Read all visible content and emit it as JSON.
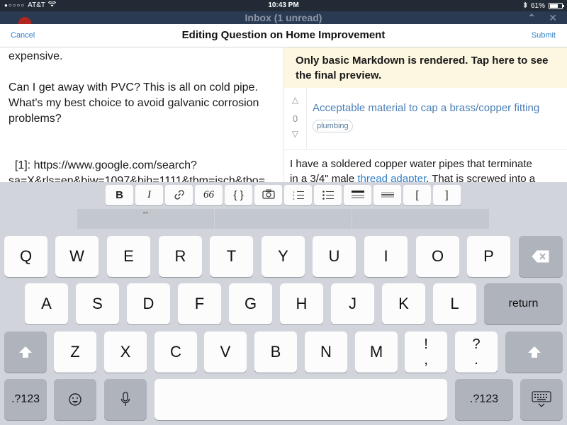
{
  "status_bar": {
    "carrier": "AT&T",
    "time": "10:43 PM",
    "battery": "61%"
  },
  "background_app": {
    "title": "Inbox (1 unread)"
  },
  "sheet": {
    "cancel_label": "Cancel",
    "title": "Editing Question on Home Improvement",
    "submit_label": "Submit"
  },
  "editor": {
    "lines": [
      "expensive.",
      "Can I get away with PVC?  This is all on cold pipe.",
      "What's my best choice to avoid galvanic corrosion",
      "problems?",
      "  [1]: https://www.google.com/search?",
      "sa=X&rls=en&biw=1097&bih=1111&tbm=isch&tbo="
    ]
  },
  "preview": {
    "notice": "Only basic Markdown is rendered. Tap here to see the final preview.",
    "vote_count": "0",
    "question_title": "Acceptable material to cap a brass/copper fitting",
    "tag": "plumbing",
    "body_line1": "I have a soldered copper water pipes that terminate",
    "body_line2_prefix": "in a 3/4\" male ",
    "body_link": "thread adapter",
    "body_line2_suffix": ". That is screwed into a"
  },
  "toolbar": {
    "bold": "B",
    "italic": "I",
    "quote": "66",
    "code": "{ }",
    "bracket_open": "[",
    "bracket_close": "]"
  },
  "predictive": {
    "suggestion": "“”"
  },
  "keyboard": {
    "row1": [
      "Q",
      "W",
      "E",
      "R",
      "T",
      "Y",
      "U",
      "I",
      "O",
      "P"
    ],
    "row2": [
      "A",
      "S",
      "D",
      "F",
      "G",
      "H",
      "J",
      "K",
      "L"
    ],
    "row3": [
      "Z",
      "X",
      "C",
      "V",
      "B",
      "N",
      "M"
    ],
    "return": "return",
    "num_left": ".?123",
    "num_right": ".?123",
    "excl_top": "!",
    "excl_bottom": ",",
    "quest_top": "?",
    "quest_bottom": "."
  }
}
